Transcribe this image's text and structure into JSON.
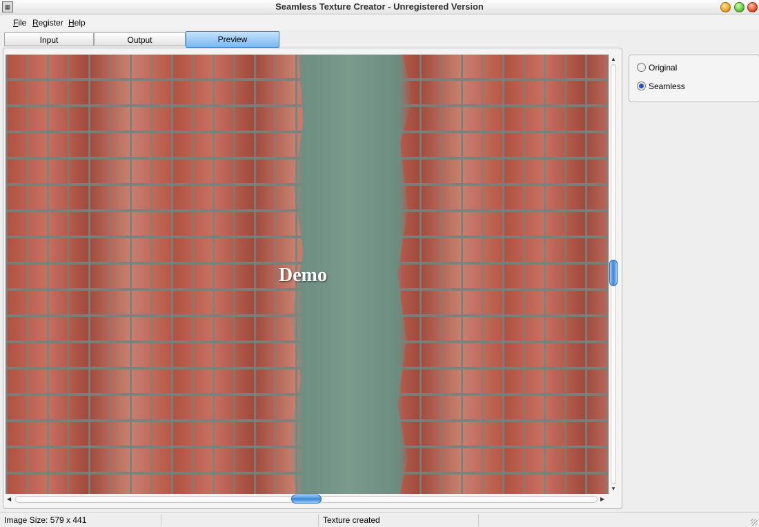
{
  "window": {
    "title": "Seamless Texture Creator - Unregistered Version",
    "app_icon": "texture-app-icon",
    "buttons": [
      "minimize",
      "maximize",
      "close"
    ]
  },
  "menu": {
    "items": [
      {
        "label": "File",
        "underline": "F",
        "rest": "ile"
      },
      {
        "label": "Register",
        "underline": "R",
        "rest": "egister"
      },
      {
        "label": "Help",
        "underline": "H",
        "rest": "elp"
      }
    ]
  },
  "tabs": [
    {
      "label": "Input",
      "active": false
    },
    {
      "label": "Output",
      "active": false
    },
    {
      "label": "Preview",
      "active": true
    }
  ],
  "preview": {
    "watermark": "Demo",
    "image_description_icon": "brick-wall-texture"
  },
  "view_mode": {
    "options": [
      {
        "label": "Original",
        "checked": false
      },
      {
        "label": "Seamless",
        "checked": true
      }
    ]
  },
  "status": {
    "image_size": "Image Size: 579 x 441",
    "message": "Texture created"
  },
  "colors": {
    "active_tab": "#7ab8f0",
    "scroll_thumb": "#3a86d8",
    "radio_selected": "#1c56b8"
  }
}
